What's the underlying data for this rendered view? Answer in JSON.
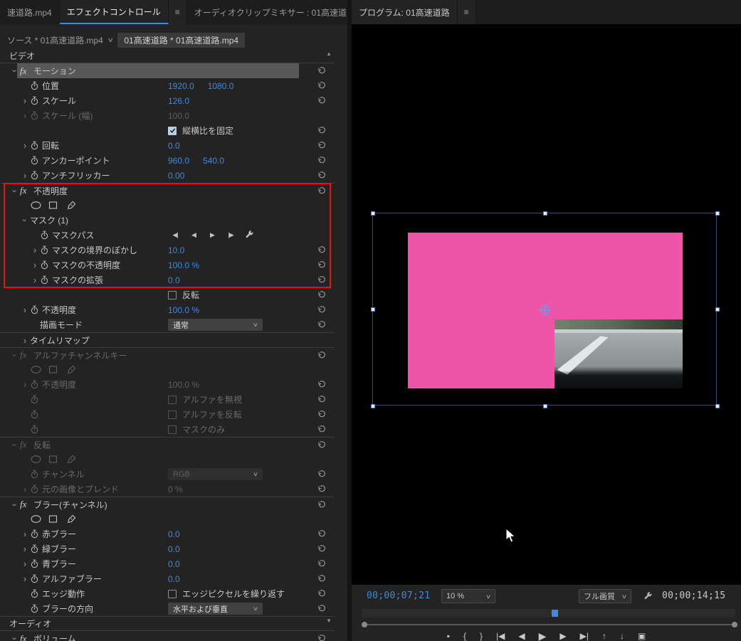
{
  "colors": {
    "accent_blue": "#3f8ae0",
    "mask_pink": "#ee54a8",
    "annotation_red": "#ee1111"
  },
  "icons": {
    "panel_menu": "≡",
    "tab_overflow": "»",
    "chevron_down": "∨",
    "expander": "›",
    "fx_badge": "fx",
    "scroll_up": "▲",
    "scroll_down": "▼"
  },
  "left_panel": {
    "tabs": [
      {
        "label": "速道路.mp4"
      },
      {
        "label": "エフェクトコントロール"
      },
      {
        "label": "オーディオクリップミキサー : 01高速道"
      }
    ],
    "source_bar": {
      "source": "ソース * 01高速道路.mp4",
      "sequence": "01高速道路 * 01高速道路.mp4"
    },
    "rows": [
      {
        "name": "video-section-header",
        "kind": "header",
        "label": "ビデオ"
      },
      {
        "name": "motion-effect",
        "kind": "fx",
        "label": "モーション",
        "selected": true,
        "reset": true
      },
      {
        "name": "position",
        "kind": "prop",
        "indent": 1,
        "stopwatch": true,
        "label": "位置",
        "values": [
          "1920.0",
          "1080.0"
        ],
        "reset": true
      },
      {
        "name": "scale",
        "kind": "prop",
        "indent": 1,
        "expander": true,
        "stopwatch": true,
        "label": "スケール",
        "values": [
          "126.0"
        ],
        "reset": true
      },
      {
        "name": "scale-width",
        "kind": "prop",
        "indent": 1,
        "expander": true,
        "stopwatch": true,
        "label": "スケール (幅)",
        "values": [
          "100.0"
        ],
        "disabled": true
      },
      {
        "name": "uniform-scale",
        "kind": "check",
        "indent": 1,
        "check_label": "縦横比を固定",
        "checked": true,
        "reset": true
      },
      {
        "name": "rotation",
        "kind": "prop",
        "indent": 1,
        "expander": true,
        "stopwatch": true,
        "label": "回転",
        "values": [
          "0.0"
        ],
        "reset": true
      },
      {
        "name": "anchor-point",
        "kind": "prop",
        "indent": 1,
        "stopwatch": true,
        "label": "アンカーポイント",
        "values": [
          "960.0",
          "540.0"
        ],
        "reset": true
      },
      {
        "name": "antiflicker",
        "kind": "prop",
        "indent": 1,
        "expander": true,
        "stopwatch": true,
        "label": "アンチフリッカー",
        "values": [
          "0.00"
        ],
        "reset": true
      },
      {
        "name": "opacity-effect",
        "kind": "fx",
        "label": "不透明度",
        "sep": true,
        "reset": true
      },
      {
        "name": "opacity-mask-tools",
        "kind": "masktools",
        "indent": 2
      },
      {
        "name": "mask-1",
        "kind": "group",
        "indent": 1,
        "label": "マスク (1)"
      },
      {
        "name": "mask-path",
        "kind": "maskpath",
        "indent": 2,
        "stopwatch": true,
        "label": "マスクパス",
        "nav": [
          "◀|",
          "◀",
          "▶",
          "|▶"
        ]
      },
      {
        "name": "mask-feather",
        "kind": "prop",
        "indent": 2,
        "expander": true,
        "stopwatch": true,
        "label": "マスクの境界のぼかし",
        "values": [
          "10.0"
        ],
        "reset": true
      },
      {
        "name": "mask-opacity",
        "kind": "prop",
        "indent": 2,
        "expander": true,
        "stopwatch": true,
        "label": "マスクの不透明度",
        "values": [
          "100.0 %"
        ],
        "reset": true
      },
      {
        "name": "mask-expansion",
        "kind": "prop",
        "indent": 2,
        "expander": true,
        "stopwatch": true,
        "label": "マスクの拡張",
        "values": [
          "0.0"
        ],
        "reset": true
      },
      {
        "name": "mask-invert",
        "kind": "check",
        "indent": 1,
        "check_label": "反転",
        "checked": false,
        "reset": true
      },
      {
        "name": "opacity",
        "kind": "prop",
        "indent": 1,
        "expander": true,
        "stopwatch": true,
        "label": "不透明度",
        "values": [
          "100.0 %"
        ],
        "reset": true
      },
      {
        "name": "blend-mode",
        "kind": "dropdown",
        "indent": 2,
        "label": "描画モード",
        "dropdown": "通常",
        "reset": true
      },
      {
        "name": "time-remapping",
        "kind": "prop",
        "indent": 1,
        "expander": true,
        "label": "タイムリマップ",
        "sep": true
      },
      {
        "name": "alpha-channel-key",
        "kind": "fx",
        "label": "アルファチャンネルキー",
        "disabled": true,
        "sep": true,
        "reset": true
      },
      {
        "name": "ack-mask-tools",
        "kind": "masktools",
        "indent": 2,
        "disabled": true
      },
      {
        "name": "ack-opacity",
        "kind": "prop",
        "indent": 1,
        "expander": true,
        "stopwatch": true,
        "label": "不透明度",
        "values": [
          "100.0 %"
        ],
        "disabled": true,
        "reset": true
      },
      {
        "name": "ignore-alpha",
        "kind": "check",
        "indent": 1,
        "stopwatch": true,
        "check_label": "アルファを無視",
        "checked": false,
        "disabled": true,
        "reset": true
      },
      {
        "name": "invert-alpha",
        "kind": "check",
        "indent": 1,
        "stopwatch": true,
        "check_label": "アルファを反転",
        "checked": false,
        "disabled": true,
        "reset": true
      },
      {
        "name": "mask-only",
        "kind": "check",
        "indent": 1,
        "stopwatch": true,
        "check_label": "マスクのみ",
        "checked": false,
        "disabled": true,
        "reset": true
      },
      {
        "name": "invert-effect",
        "kind": "fx",
        "label": "反転",
        "disabled": true,
        "sep": true,
        "reset": true
      },
      {
        "name": "invert-mask-tools",
        "kind": "masktools",
        "indent": 2,
        "disabled": true
      },
      {
        "name": "channel",
        "kind": "dropdown",
        "indent": 1,
        "stopwatch": true,
        "label": "チャンネル",
        "dropdown": "RGB",
        "disabled": true,
        "reset": true
      },
      {
        "name": "blend-with-original",
        "kind": "prop",
        "indent": 1,
        "expander": true,
        "stopwatch": true,
        "label": "元の画像とブレンド",
        "values": [
          "0 %"
        ],
        "disabled": true,
        "reset": true
      },
      {
        "name": "channel-blur-effect",
        "kind": "fx",
        "label": "ブラー(チャンネル)",
        "sep": true,
        "reset": true
      },
      {
        "name": "blur-mask-tools",
        "kind": "masktools",
        "indent": 2
      },
      {
        "name": "red-blur",
        "kind": "prop",
        "indent": 1,
        "expander": true,
        "stopwatch": true,
        "label": "赤ブラー",
        "values": [
          "0.0"
        ],
        "reset": true
      },
      {
        "name": "green-blur",
        "kind": "prop",
        "indent": 1,
        "expander": true,
        "stopwatch": true,
        "label": "緑ブラー",
        "values": [
          "0.0"
        ],
        "reset": true
      },
      {
        "name": "blue-blur",
        "kind": "prop",
        "indent": 1,
        "expander": true,
        "stopwatch": true,
        "label": "青ブラー",
        "values": [
          "0.0"
        ],
        "reset": true
      },
      {
        "name": "alpha-blur",
        "kind": "prop",
        "indent": 1,
        "expander": true,
        "stopwatch": true,
        "label": "アルファブラー",
        "values": [
          "0.0"
        ],
        "reset": true
      },
      {
        "name": "edge-behavior",
        "kind": "check",
        "indent": 1,
        "stopwatch": true,
        "label": "エッジ動作",
        "check_label": "エッジピクセルを繰り返す",
        "checked": false,
        "reset": true
      },
      {
        "name": "blur-direction",
        "kind": "dropdown",
        "indent": 1,
        "stopwatch": true,
        "label": "ブラーの方向",
        "dropdown": "水平および垂直",
        "reset": true
      },
      {
        "name": "audio-section-header",
        "kind": "header",
        "label": "オーディオ",
        "sep": true
      },
      {
        "name": "volume-effect",
        "kind": "fx",
        "label": "ボリューム",
        "reset": true
      }
    ]
  },
  "program_panel": {
    "tab": "プログラム: 01高速道路",
    "current_timecode": "00;00;07;21",
    "zoom_level": "10 %",
    "quality": "フル画質",
    "duration_timecode": "00;00;14;15",
    "transport": [
      {
        "name": "add-marker-button",
        "glyph": "▪"
      },
      {
        "name": "mark-in-button",
        "glyph": "{"
      },
      {
        "name": "mark-out-button",
        "glyph": "}"
      },
      {
        "name": "go-to-in-button",
        "glyph": "|◀"
      },
      {
        "name": "step-back-button",
        "glyph": "◀"
      },
      {
        "name": "play-button",
        "glyph": "▶"
      },
      {
        "name": "step-forward-button",
        "glyph": "▶"
      },
      {
        "name": "go-to-out-button",
        "glyph": "▶|"
      },
      {
        "name": "lift-button",
        "glyph": "↑"
      },
      {
        "name": "extract-button",
        "glyph": "↓"
      },
      {
        "name": "export-frame-button",
        "glyph": "▣"
      }
    ]
  }
}
